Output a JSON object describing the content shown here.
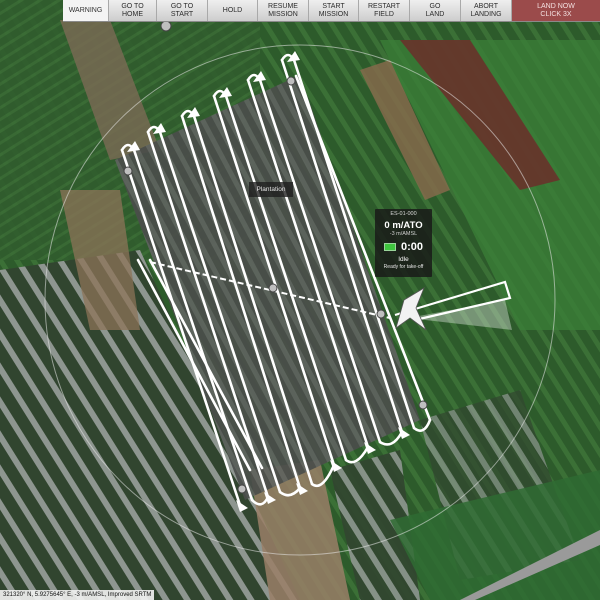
{
  "toolbar": {
    "warning_label": "WARNING",
    "go_to_home_label": "GO TO\nHOME",
    "go_to_start_label": "GO TO\nSTART",
    "hold_label": "HOLD",
    "resume_mission_label": "RESUME\nMISSION",
    "start_mission_label": "START\nMISSION",
    "restart_field_label": "RESTART\nFIELD",
    "go_land_label": "GO\nLAND",
    "abort_landing_label": "ABORT\nLANDING",
    "land_now_label": "LAND NOW\nClick 3x"
  },
  "map": {
    "field_label": "Plantation"
  },
  "drone": {
    "id": "ES-01-000",
    "altitude": "0 m/ATO",
    "altitude_amsl": "-3 m/AMSL",
    "timer": "0:00",
    "status": "Idle",
    "substatus": "Ready for take-off"
  },
  "status_bar": {
    "coordinates": "321320° N, 5.9275645° E, -3 m/AMSL, Improved SRTM"
  },
  "colors": {
    "land_now": "#9b4b4b",
    "battery": "#3fc53f",
    "path": "#ffffff"
  }
}
